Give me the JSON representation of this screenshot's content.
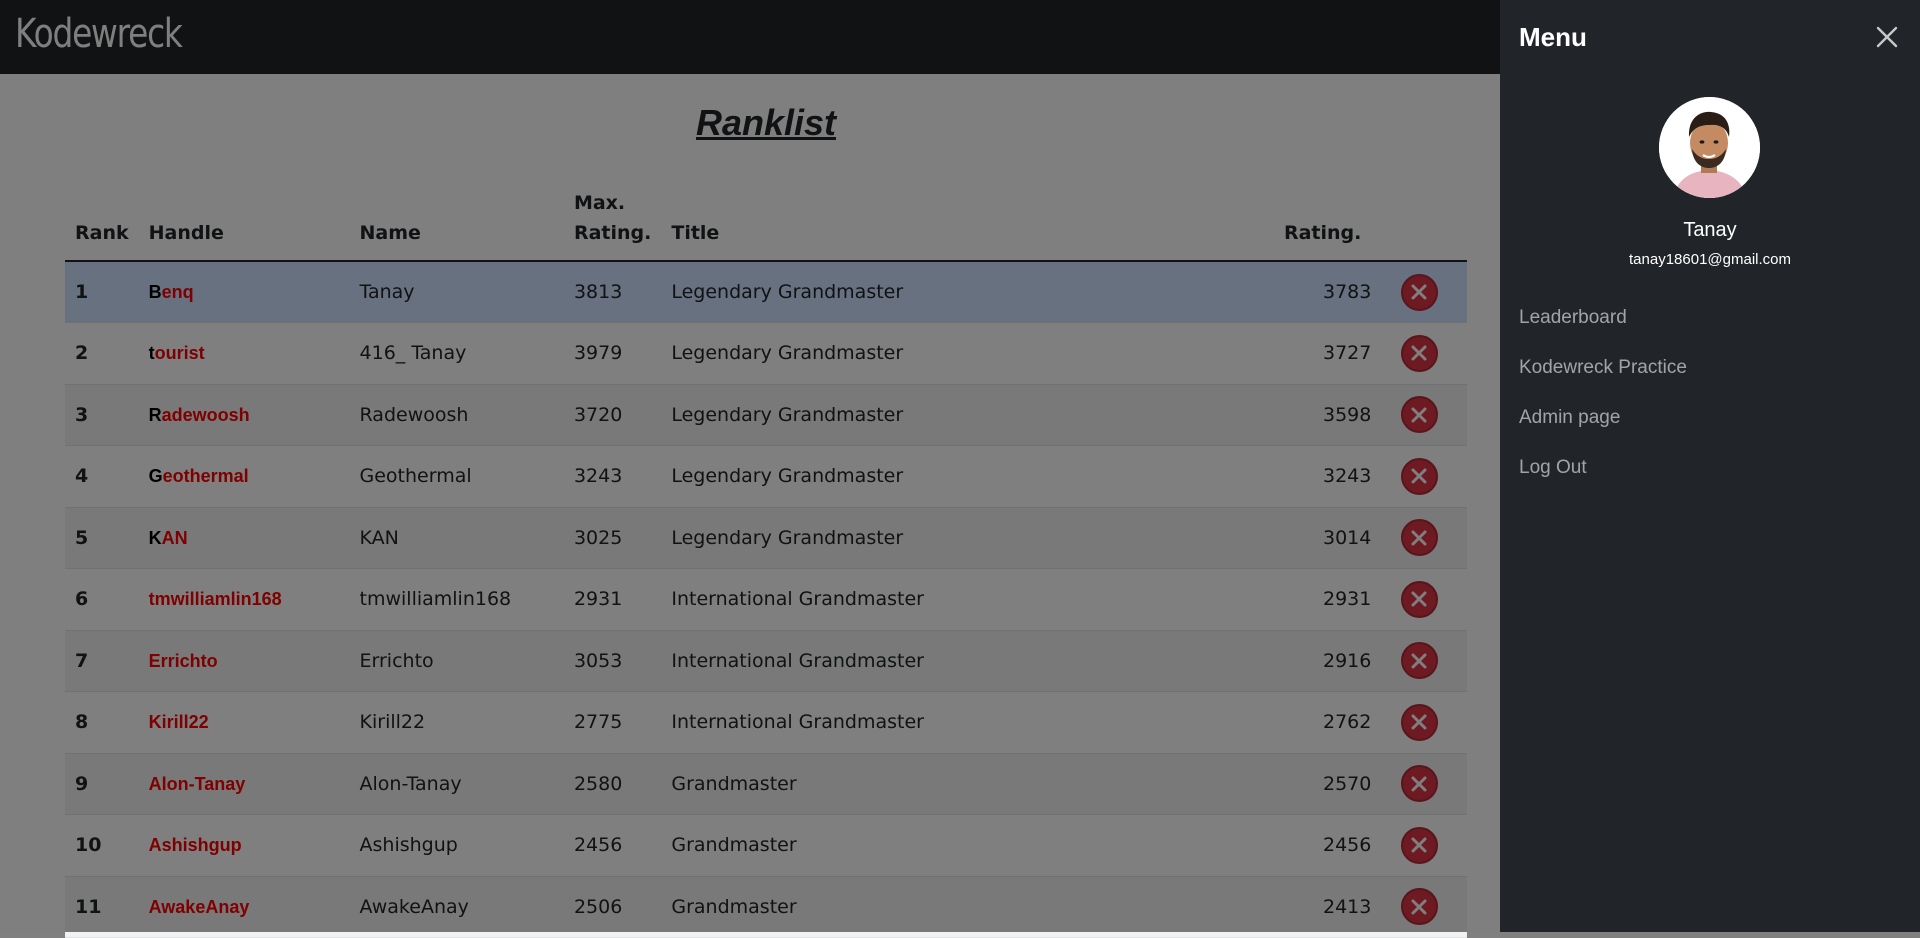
{
  "navbar": {
    "brand": "Kodewreck"
  },
  "page": {
    "title": "Ranklist"
  },
  "table": {
    "headers": {
      "rank": "Rank",
      "handle": "Handle",
      "name": "Name",
      "max_rating_line1": "Max.",
      "max_rating_line2": "Rating.",
      "title": "Title",
      "rating": "Rating."
    },
    "rows": [
      {
        "rank": "1",
        "handle_first": "B",
        "handle_rest": "enq",
        "name": "Tanay",
        "max_rating": "3813",
        "title": "Legendary Grandmaster",
        "rating": "3783"
      },
      {
        "rank": "2",
        "handle_first": "t",
        "handle_rest": "ourist",
        "name": "416_ Tanay",
        "max_rating": "3979",
        "title": "Legendary Grandmaster",
        "rating": "3727"
      },
      {
        "rank": "3",
        "handle_first": "R",
        "handle_rest": "adewoosh",
        "name": "Radewoosh",
        "max_rating": "3720",
        "title": "Legendary Grandmaster",
        "rating": "3598"
      },
      {
        "rank": "4",
        "handle_first": "G",
        "handle_rest": "eothermal",
        "name": "Geothermal",
        "max_rating": "3243",
        "title": "Legendary Grandmaster",
        "rating": "3243"
      },
      {
        "rank": "5",
        "handle_first": "K",
        "handle_rest": "AN",
        "name": "KAN",
        "max_rating": "3025",
        "title": "Legendary Grandmaster",
        "rating": "3014"
      },
      {
        "rank": "6",
        "handle_first": "",
        "handle_rest": "tmwilliamlin168",
        "name": "tmwilliamlin168",
        "max_rating": "2931",
        "title": "International Grandmaster",
        "rating": "2931"
      },
      {
        "rank": "7",
        "handle_first": "",
        "handle_rest": "Errichto",
        "name": "Errichto",
        "max_rating": "3053",
        "title": "International Grandmaster",
        "rating": "2916"
      },
      {
        "rank": "8",
        "handle_first": "",
        "handle_rest": "Kirill22",
        "name": "Kirill22",
        "max_rating": "2775",
        "title": "International Grandmaster",
        "rating": "2762"
      },
      {
        "rank": "9",
        "handle_first": "",
        "handle_rest": "Alon-Tanay",
        "name": "Alon-Tanay",
        "max_rating": "2580",
        "title": "Grandmaster",
        "rating": "2570"
      },
      {
        "rank": "10",
        "handle_first": "",
        "handle_rest": "Ashishgup",
        "name": "Ashishgup",
        "max_rating": "2456",
        "title": "Grandmaster",
        "rating": "2456"
      },
      {
        "rank": "11",
        "handle_first": "",
        "handle_rest": "AwakeAnay",
        "name": "AwakeAnay",
        "max_rating": "2506",
        "title": "Grandmaster",
        "rating": "2413"
      }
    ]
  },
  "menu": {
    "title": "Menu",
    "user_name": "Tanay",
    "user_email": "tanay18601@gmail.com",
    "items": [
      {
        "label": "Leaderboard"
      },
      {
        "label": "Kodewreck Practice"
      },
      {
        "label": "Admin page"
      },
      {
        "label": "Log Out"
      }
    ]
  },
  "colors": {
    "navbar_bg": "#212529",
    "handle_red": "#ff0000",
    "delete_red": "#dc3545",
    "active_row": "#cfe2ff",
    "menu_link": "rgba(255,255,255,0.58)"
  },
  "icons": {
    "delete": "x-circle-icon",
    "close": "close-icon",
    "avatar": "user-avatar"
  }
}
